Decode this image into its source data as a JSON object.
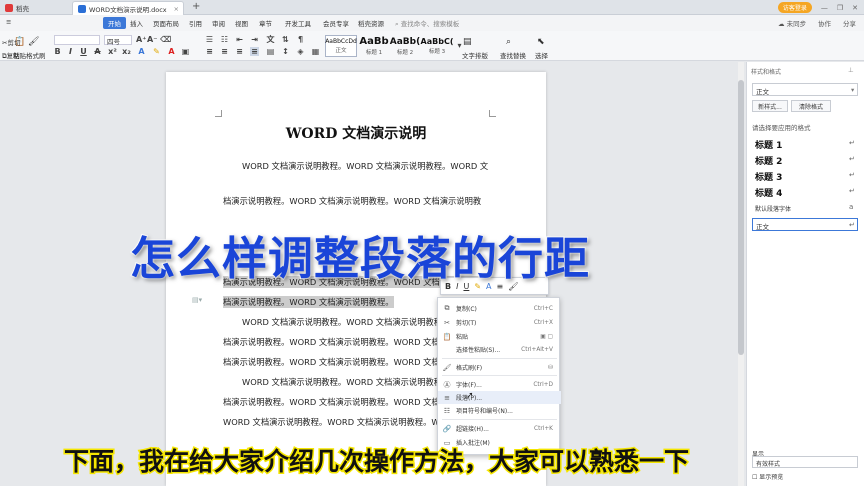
{
  "tabs": {
    "home": "稻壳",
    "doc": "WORD文档演示说明.docx",
    "add": "+"
  },
  "window": {
    "user_badge": "访客登录",
    "not_synced": "未同步",
    "collaborate": "协作",
    "share": "分享"
  },
  "menu": {
    "items": [
      "开始",
      "插入",
      "页面布局",
      "引用",
      "审阅",
      "视图",
      "章节",
      "开发工具",
      "会员专享",
      "稻壳资源"
    ],
    "search_placeholder": "查找命令、搜索模板"
  },
  "ribbon": {
    "paste": "粘贴",
    "cut": "剪切",
    "copy": "复制",
    "format_painter": "格式刷",
    "font_size": "四号",
    "styles": [
      {
        "sample": "AaBbCcDd",
        "name": "正文"
      },
      {
        "sample": "AaBb",
        "name": "标题 1"
      },
      {
        "sample": "AaBb(",
        "name": "标题 2"
      },
      {
        "sample": "AaBbC(",
        "name": "标题 3"
      }
    ],
    "text_layout": "文字排版",
    "find_replace": "查找替换",
    "select": "选择"
  },
  "document": {
    "title": "WORD 文档演示说明",
    "lines": [
      "WORD 文档演示说明教程。WORD 文档演示说明教程。WORD 文",
      "档演示说明教程。WORD 文档演示说明教程。WORD 文档演示说明教",
      "档演示说明教程。WORD 文档演示说明教程。WORD 文档演示说明教",
      "档演示说明教程。WORD 文档演示说明教程。",
      "WORD 文档演示说明教程。WORD 文档演示说明教程。WORD 文",
      "档演示说明教程。WORD 文档演示说明教程。WORD 文档演示说明教",
      "档演示说明教程。WORD 文档演示说明教程。WORD 文档演示说明教",
      "WORD 文档演示说明教程。WORD 文档演示说明教程。WORD 文",
      "档演示说明教程。WORD 文档演示说明教程。WORD 文档演示说明教"
    ]
  },
  "context_menu": {
    "items": [
      {
        "label": "复制(C)",
        "shortcut": "Ctrl+C",
        "icon": "copy-icon"
      },
      {
        "label": "剪切(T)",
        "shortcut": "Ctrl+X",
        "icon": "cut-icon"
      },
      {
        "label": "粘贴",
        "shortcut": "",
        "icon": "paste-icon"
      },
      {
        "label": "选择性粘贴(S)...",
        "shortcut": "Ctrl+Alt+V",
        "icon": "paste-special-icon"
      },
      {
        "label": "格式刷(F)",
        "shortcut": "",
        "icon": "format-painter-icon"
      },
      {
        "label": "字体(F)...",
        "shortcut": "Ctrl+D",
        "icon": "font-icon"
      },
      {
        "label": "段落(P)...",
        "shortcut": "",
        "icon": "paragraph-icon"
      },
      {
        "label": "项目符号和编号(N)...",
        "shortcut": "",
        "icon": "bullets-icon"
      },
      {
        "label": "超链接(H)...",
        "shortcut": "Ctrl+K",
        "icon": "link-icon"
      },
      {
        "label": "插入批注(M)",
        "shortcut": "",
        "icon": "comment-icon"
      }
    ]
  },
  "panel": {
    "header": "样式和格式",
    "current_style": "正文",
    "new_style": "新样式...",
    "clear_format": "清除格式",
    "apply_label": "请选择要应用的格式",
    "headings": [
      "标题 1",
      "标题 2",
      "标题 3",
      "标题 4"
    ],
    "default_font": "默认段落字体",
    "body_style": "正文",
    "show_label": "显示",
    "show_value": "有效样式",
    "preview": "显示预览"
  },
  "overlay": {
    "title": "怎么样调整段落的行距",
    "subtitle": "下面，我在给大家介绍几次操作方法，大家可以熟悉一下"
  },
  "colors": {
    "accent": "#3c78d8",
    "overlay_title": "#1a45d8",
    "subtitle_stroke": "#f5e600"
  }
}
